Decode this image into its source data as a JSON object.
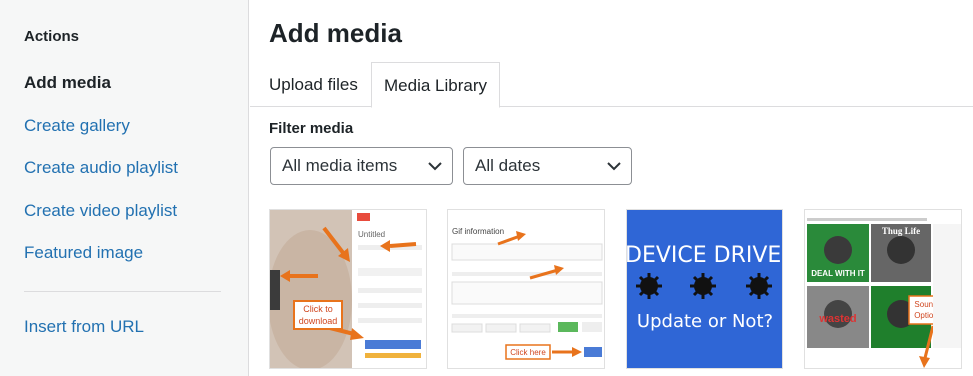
{
  "sidebar": {
    "heading": "Actions",
    "items": [
      {
        "label": "Add media"
      },
      {
        "label": "Create gallery"
      },
      {
        "label": "Create audio playlist"
      },
      {
        "label": "Create video playlist"
      },
      {
        "label": "Featured image"
      },
      {
        "label": "Insert from URL"
      }
    ]
  },
  "main": {
    "title": "Add media",
    "tabs": [
      {
        "label": "Upload files"
      },
      {
        "label": "Media Library"
      }
    ],
    "filter_label": "Filter media",
    "filters": [
      {
        "value": "All media items"
      },
      {
        "value": "All dates"
      }
    ],
    "thumbnails": [
      {
        "name": "download-guide",
        "callout": [
          "Click to",
          "download"
        ],
        "header_text": "Untitled"
      },
      {
        "name": "gif-information",
        "header_text": "Gif information",
        "callout": [
          "Click here"
        ]
      },
      {
        "name": "device-driver",
        "text_top": "DEVICE DRIVER",
        "text_bottom": "Update or Not?"
      },
      {
        "name": "sound-option",
        "callout": [
          "Sound",
          "Option"
        ],
        "tiles": [
          "DEAL WITH IT",
          "Thug Life",
          "wasted",
          ""
        ]
      }
    ]
  },
  "colors": {
    "link": "#2271b1",
    "text": "#1d2327",
    "sidebar_bg": "#f6f7f7",
    "callout_orange": "#e8731c",
    "driver_blue": "#2f66d6"
  }
}
